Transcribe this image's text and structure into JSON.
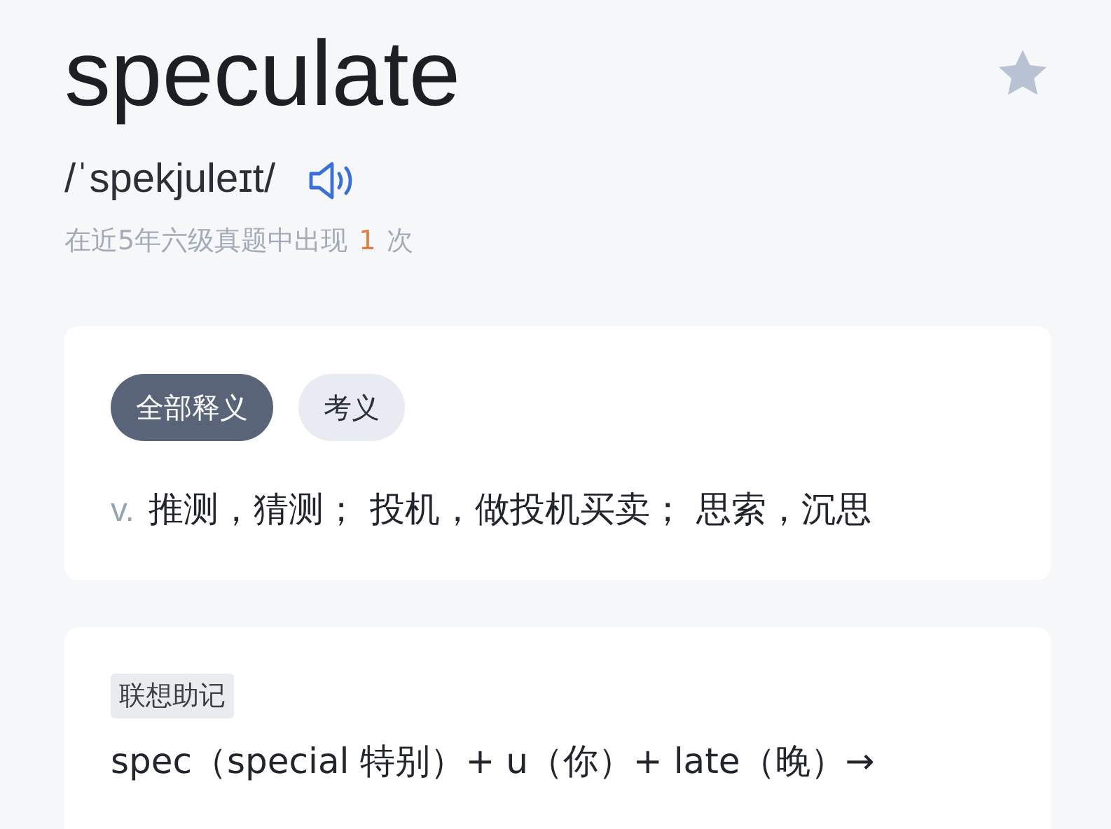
{
  "word": {
    "headword": "speculate",
    "starred": false,
    "phonetic": "/ˈspekjuleɪt/",
    "frequency": {
      "before": "在近5年六级真题中出现",
      "count": "1",
      "after": "次"
    }
  },
  "definitions": {
    "tabs": [
      {
        "label": "全部释义",
        "selected": true
      },
      {
        "label": "考义",
        "selected": false
      }
    ],
    "entries": [
      {
        "pos": "v.",
        "meaning": "推测，猜测； 投机，做投机买卖； 思索，沉思"
      }
    ]
  },
  "mnemonic": {
    "tag": "联想助记",
    "text": "spec（special 特别）+ u（你）+ late（晚）→"
  }
}
